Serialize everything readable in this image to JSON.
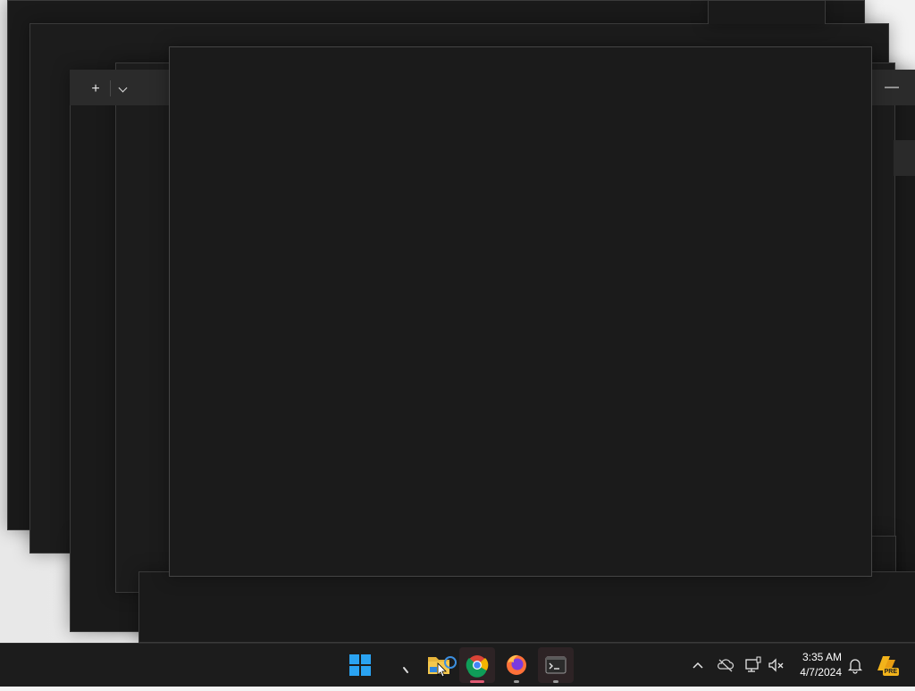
{
  "terminal": {
    "new_tab_label": "+",
    "minimize_label": "—"
  },
  "taskbar": {
    "items": [
      {
        "name": "Start",
        "icon": "windows-logo-icon"
      },
      {
        "name": "Search",
        "icon": "search-icon"
      },
      {
        "name": "File Explorer",
        "icon": "folder-icon"
      },
      {
        "name": "Google Chrome",
        "icon": "chrome-icon"
      },
      {
        "name": "Firefox",
        "icon": "firefox-icon"
      },
      {
        "name": "Terminal",
        "icon": "terminal-icon"
      }
    ],
    "tray": {
      "show_hidden_icon": "chevron-up-icon",
      "onedrive_icon": "cloud-offline-icon",
      "network_icon": "network-icon",
      "volume_icon": "speaker-muted-icon",
      "notification_icon": "bell-icon",
      "copilot_icon": "copilot-pre-icon",
      "copilot_badge": "PRE"
    },
    "clock": {
      "time": "3:35 AM",
      "date": "4/7/2024"
    }
  },
  "colors": {
    "window_bg": "#1a1a1a",
    "titlebar_bg": "#2b2b2b",
    "taskbar_bg": "#1c1c1c",
    "accent_blue": "#2aa3f2",
    "active_indicator": "#e05a73"
  }
}
